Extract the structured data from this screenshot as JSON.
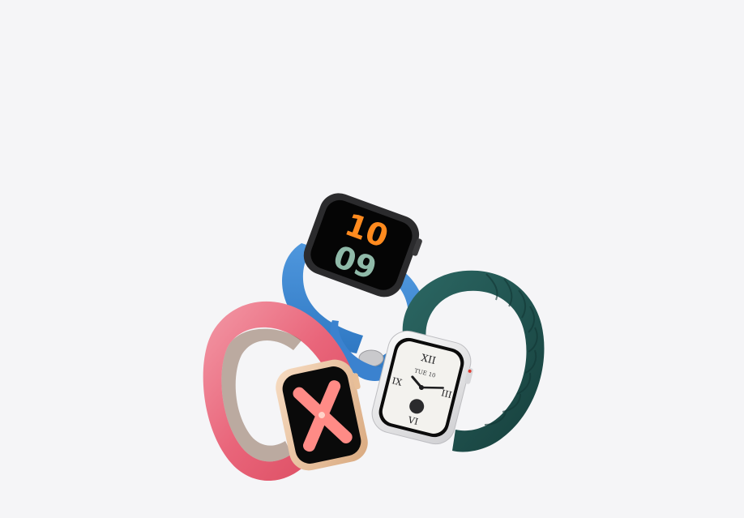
{
  "background": "#f5f5f7",
  "watches": [
    {
      "id": "blue-sport-band-watch",
      "band_color": "#3d86d1",
      "case_color": "#2b2b2d",
      "face": {
        "hour_top": "10",
        "hour_bottom": "09",
        "top_digit_color": "#ff8a1e",
        "bottom_digit_color": "#8fb9a8"
      }
    },
    {
      "id": "pink-loop-watch",
      "band_color": "#e9657a",
      "case_color": "#f0c9a6",
      "face": {
        "color": "#ff8b86"
      }
    },
    {
      "id": "green-leather-loop-watch",
      "band_color": "#1f4f4c",
      "case_color": "#e9e9ea",
      "face": {
        "numerals": [
          "XII",
          "III",
          "VI",
          "IX"
        ],
        "dial_color": "#f3f2ee",
        "complication_text": "TUE 10"
      }
    }
  ]
}
